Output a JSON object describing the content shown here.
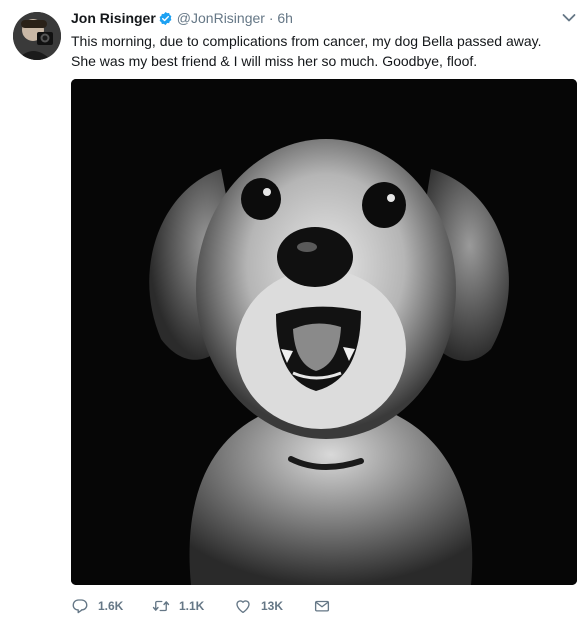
{
  "tweet": {
    "author": {
      "name": "Jon Risinger",
      "handle": "@JonRisinger",
      "verified": true
    },
    "separator": "·",
    "time": "6h",
    "text_lines": [
      "This morning, due to complications from cancer, my dog Bella passed away.",
      "She was my best friend & I will miss her so much. Goodbye, floof."
    ],
    "actions": {
      "replies": "1.6K",
      "retweets": "1.1K",
      "likes": "13K"
    }
  },
  "icons": {
    "verified": "verified-badge-icon",
    "caret": "chevron-down-icon",
    "reply": "reply-icon",
    "retweet": "retweet-icon",
    "like": "heart-icon",
    "dm": "envelope-icon"
  },
  "colors": {
    "text": "#14171a",
    "secondary": "#657786",
    "verified": "#1da1f2"
  }
}
